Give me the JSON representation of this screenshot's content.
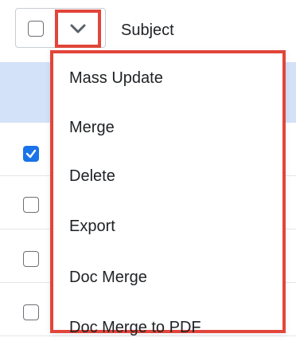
{
  "header": {
    "select_all_checked": false,
    "dropdown_toggle_icon": "chevron-down-icon",
    "subject_label": "Subject"
  },
  "rows": [
    {
      "checked": true
    },
    {
      "checked": false
    },
    {
      "checked": false
    },
    {
      "checked": false
    }
  ],
  "menu": {
    "items": [
      {
        "label": "Mass Update"
      },
      {
        "label": "Merge"
      },
      {
        "label": "Delete"
      },
      {
        "label": "Export"
      },
      {
        "label": "Doc Merge"
      },
      {
        "label": "Doc Merge to PDF"
      }
    ]
  },
  "colors": {
    "highlight_border": "#e2453a",
    "checkbox_checked": "#1a73e8",
    "selected_row_band": "#d3e2f8"
  }
}
